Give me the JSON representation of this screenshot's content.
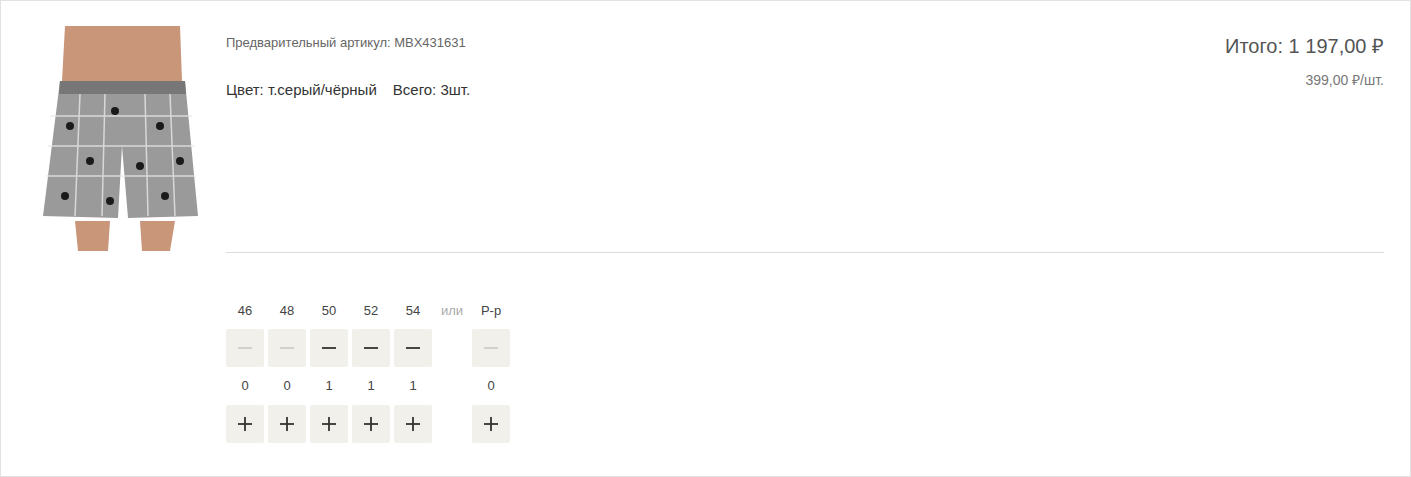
{
  "product": {
    "article": "Предварительный артикул: MBX431631",
    "color": "Цвет: т.серый/чёрный",
    "quantity": "Всего: 3шт.",
    "total": "Итого: 1 197,00 ₽",
    "unit_price": "399,00 ₽/шт."
  },
  "sizes": [
    {
      "label": "46",
      "count": "0",
      "minus_disabled": true
    },
    {
      "label": "48",
      "count": "0",
      "minus_disabled": true
    },
    {
      "label": "50",
      "count": "1",
      "minus_disabled": false
    },
    {
      "label": "52",
      "count": "1",
      "minus_disabled": false
    },
    {
      "label": "54",
      "count": "1",
      "minus_disabled": false
    }
  ],
  "separator": "или",
  "custom_size": {
    "label": "Р-р",
    "count": "0",
    "minus_disabled": true
  }
}
